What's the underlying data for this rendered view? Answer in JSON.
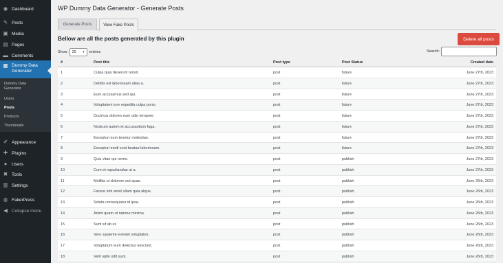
{
  "sidebar": {
    "items": [
      {
        "label": "Dashboard",
        "icon": "dashboard-icon",
        "glyph": "◉"
      },
      {
        "label": "Posts",
        "icon": "pin-icon",
        "glyph": "✎"
      },
      {
        "label": "Media",
        "icon": "media-icon",
        "glyph": "▣"
      },
      {
        "label": "Pages",
        "icon": "pages-icon",
        "glyph": "▤"
      },
      {
        "label": "Comments",
        "icon": "comments-icon",
        "glyph": "▬"
      },
      {
        "label": "Dummy Data Generator",
        "icon": "generator-icon",
        "glyph": "▦"
      },
      {
        "label": "Appearance",
        "icon": "brush-icon",
        "glyph": "✐"
      },
      {
        "label": "Plugins",
        "icon": "plugin-icon",
        "glyph": "✚"
      },
      {
        "label": "Users",
        "icon": "users-icon",
        "glyph": "●"
      },
      {
        "label": "Tools",
        "icon": "wrench-icon",
        "glyph": "✖"
      },
      {
        "label": "Settings",
        "icon": "settings-icon",
        "glyph": "▥"
      },
      {
        "label": "FakerPress",
        "icon": "fakerpress-icon",
        "glyph": "◍"
      }
    ],
    "submenu": [
      "Dummy Data Generator",
      "Users",
      "Posts",
      "Products",
      "Thumbnails"
    ],
    "collapse_label": "Collapse menu",
    "collapse_glyph": "◀"
  },
  "page": {
    "title": "WP Dummy Data Generator - Generate Posts",
    "tabs": [
      "Generate Posts",
      "View Fake Posts"
    ],
    "heading": "Bellow are all the posts generated by this plugin",
    "delete_label": "Delete all posts",
    "show_label": "Show",
    "show_value": "25",
    "entries_label": "entries",
    "search_label": "Search:",
    "search_value": ""
  },
  "table": {
    "headers": [
      "#",
      "Post title",
      "Post type",
      "Post Status",
      "Created date"
    ],
    "rows": [
      [
        "1",
        "Culpa quia deserunt rerum.",
        "post",
        "future",
        "June 27th, 2023"
      ],
      [
        "2",
        "Debitis est laboriosam alias a.",
        "post",
        "future",
        "June 27th, 2023"
      ],
      [
        "3",
        "Eum accusamus sed qui.",
        "post",
        "future",
        "June 27th, 2023"
      ],
      [
        "4",
        "Voluptatem iure expedita culpa porro.",
        "post",
        "future",
        "June 27th, 2023"
      ],
      [
        "5",
        "Ducimus dolores eum odio tempore.",
        "post",
        "future",
        "June 27th, 2023"
      ],
      [
        "6",
        "Nostrum autem et accusantium fuga.",
        "post",
        "future",
        "June 27th, 2023"
      ],
      [
        "7",
        "Excepturi eum tenetur molestiae.",
        "post",
        "future",
        "June 27th, 2023"
      ],
      [
        "8",
        "Excepturi modi sunt beatae laboriosam.",
        "post",
        "future",
        "June 27th, 2023"
      ],
      [
        "9",
        "Quis vitae qui nemo.",
        "post",
        "publish",
        "June 27th, 2023"
      ],
      [
        "10",
        "Cum et repudiandae ut a.",
        "post",
        "publish",
        "June 27th, 2023"
      ],
      [
        "11",
        "Mollitia ut dolorem aut quae.",
        "post",
        "publish",
        "June 26th, 2023"
      ],
      [
        "12",
        "Facere sint amet ullam quia atque.",
        "post",
        "publish",
        "June 26th, 2023"
      ],
      [
        "13",
        "Soluta consequatur id ipsa.",
        "post",
        "publish",
        "June 26th, 2023"
      ],
      [
        "14",
        "Animi quam ut ratione minima.",
        "post",
        "publish",
        "June 26th, 2023"
      ],
      [
        "15",
        "Sunt sit ab ut.",
        "post",
        "publish",
        "June 26th, 2023"
      ],
      [
        "16",
        "Vero sapiente eveniet voluptates.",
        "post",
        "publish",
        "June 26th, 2023"
      ],
      [
        "17",
        "Voluptatum eum delectus nesciunt.",
        "post",
        "publish",
        "June 26th, 2023"
      ],
      [
        "18",
        "Velit optio odit sunt.",
        "post",
        "publish",
        "June 26th, 2023"
      ]
    ]
  }
}
